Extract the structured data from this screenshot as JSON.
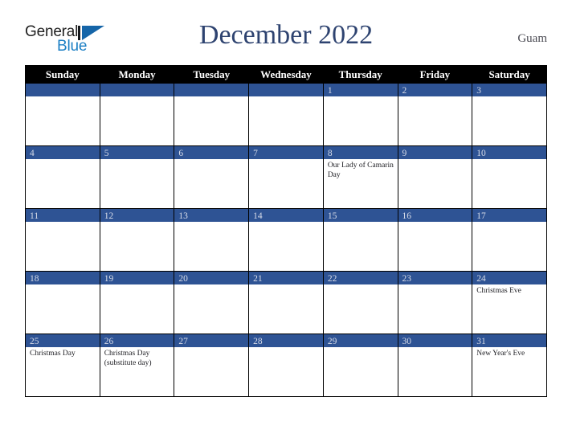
{
  "brand": {
    "name_part1": "General",
    "name_part2": "Blue",
    "logo_icon": "triangle-icon"
  },
  "header": {
    "title": "December 2022",
    "region": "Guam"
  },
  "colors": {
    "day_bar": "#2e5394",
    "header_row": "#000000",
    "title": "#2e4370",
    "brand_blue": "#1b7fc4",
    "logo_triangle": "#1565a8"
  },
  "calendar": {
    "weekday_headers": [
      "Sunday",
      "Monday",
      "Tuesday",
      "Wednesday",
      "Thursday",
      "Friday",
      "Saturday"
    ],
    "weeks": [
      [
        {
          "day": "",
          "events": []
        },
        {
          "day": "",
          "events": []
        },
        {
          "day": "",
          "events": []
        },
        {
          "day": "",
          "events": []
        },
        {
          "day": "1",
          "events": []
        },
        {
          "day": "2",
          "events": []
        },
        {
          "day": "3",
          "events": []
        }
      ],
      [
        {
          "day": "4",
          "events": []
        },
        {
          "day": "5",
          "events": []
        },
        {
          "day": "6",
          "events": []
        },
        {
          "day": "7",
          "events": []
        },
        {
          "day": "8",
          "events": [
            "Our Lady of Camarin Day"
          ]
        },
        {
          "day": "9",
          "events": []
        },
        {
          "day": "10",
          "events": []
        }
      ],
      [
        {
          "day": "11",
          "events": []
        },
        {
          "day": "12",
          "events": []
        },
        {
          "day": "13",
          "events": []
        },
        {
          "day": "14",
          "events": []
        },
        {
          "day": "15",
          "events": []
        },
        {
          "day": "16",
          "events": []
        },
        {
          "day": "17",
          "events": []
        }
      ],
      [
        {
          "day": "18",
          "events": []
        },
        {
          "day": "19",
          "events": []
        },
        {
          "day": "20",
          "events": []
        },
        {
          "day": "21",
          "events": []
        },
        {
          "day": "22",
          "events": []
        },
        {
          "day": "23",
          "events": []
        },
        {
          "day": "24",
          "events": [
            "Christmas Eve"
          ]
        }
      ],
      [
        {
          "day": "25",
          "events": [
            "Christmas Day"
          ]
        },
        {
          "day": "26",
          "events": [
            "Christmas Day (substitute day)"
          ]
        },
        {
          "day": "27",
          "events": []
        },
        {
          "day": "28",
          "events": []
        },
        {
          "day": "29",
          "events": []
        },
        {
          "day": "30",
          "events": []
        },
        {
          "day": "31",
          "events": [
            "New Year's Eve"
          ]
        }
      ]
    ]
  }
}
